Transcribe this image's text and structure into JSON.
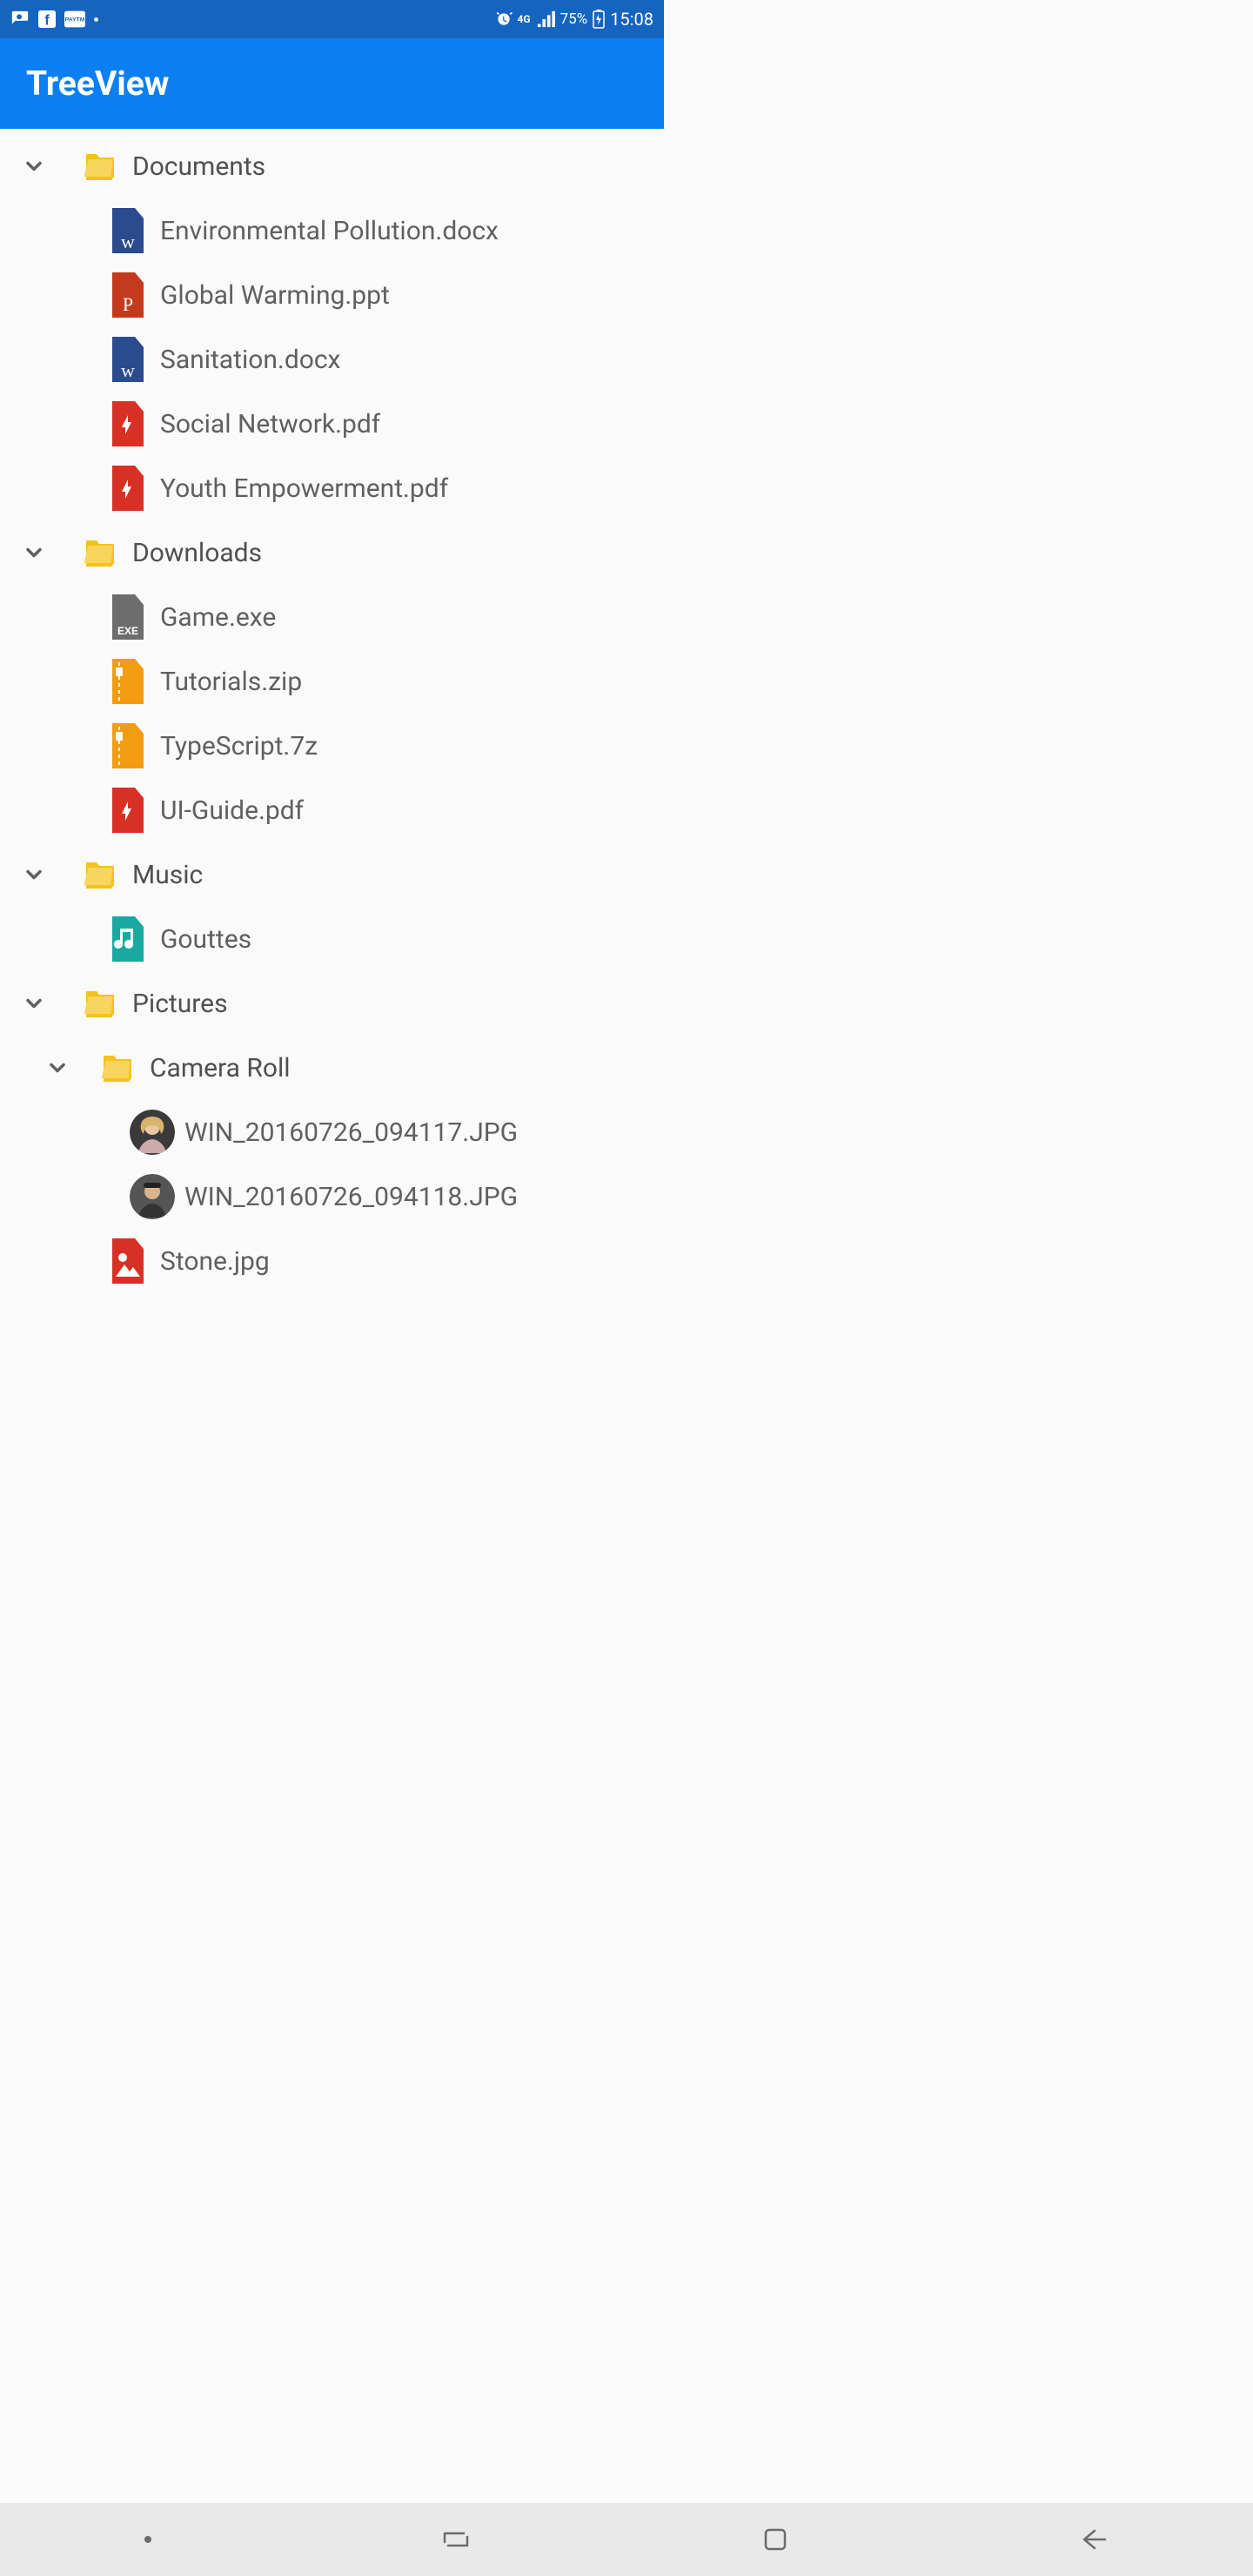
{
  "status_bar": {
    "battery_pct": "75%",
    "network_label": "4G",
    "time": "15:08"
  },
  "header": {
    "title": "TreeView"
  },
  "tree": [
    {
      "name": "Documents",
      "type": "folder",
      "children": [
        {
          "name": "Environmental Pollution.docx",
          "icon": "word"
        },
        {
          "name": "Global Warming.ppt",
          "icon": "ppt"
        },
        {
          "name": "Sanitation.docx",
          "icon": "word"
        },
        {
          "name": "Social Network.pdf",
          "icon": "pdf"
        },
        {
          "name": "Youth Empowerment.pdf",
          "icon": "pdf"
        }
      ]
    },
    {
      "name": "Downloads",
      "type": "folder",
      "children": [
        {
          "name": "Game.exe",
          "icon": "exe"
        },
        {
          "name": "Tutorials.zip",
          "icon": "zip"
        },
        {
          "name": "TypeScript.7z",
          "icon": "zip"
        },
        {
          "name": "UI-Guide.pdf",
          "icon": "pdf"
        }
      ]
    },
    {
      "name": "Music",
      "type": "folder",
      "children": [
        {
          "name": "Gouttes",
          "icon": "music"
        }
      ]
    },
    {
      "name": "Pictures",
      "type": "folder",
      "children": [
        {
          "name": "Camera Roll",
          "type": "folder",
          "children": [
            {
              "name": "WIN_20160726_094117.JPG",
              "icon": "avatar1"
            },
            {
              "name": "WIN_20160726_094118.JPG",
              "icon": "avatar2"
            }
          ]
        },
        {
          "name": "Stone.jpg",
          "icon": "image"
        }
      ]
    }
  ]
}
